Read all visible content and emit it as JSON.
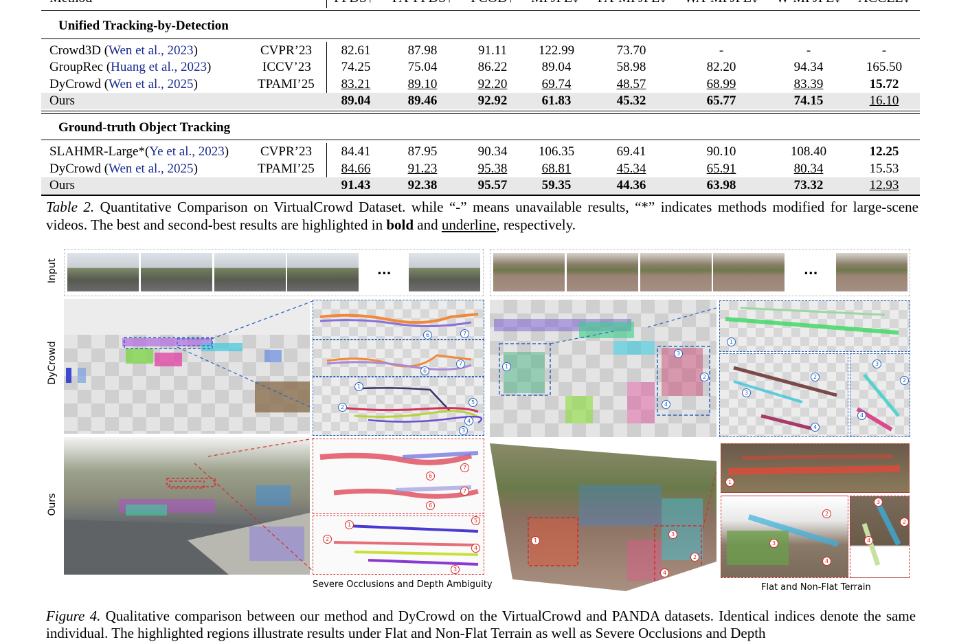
{
  "table": {
    "header": {
      "method": "Method",
      "cols": [
        "PFDS↑",
        "PA-PFDS↑",
        "PCOD↑",
        "MPJPE↓",
        "PA-MPJPE↓",
        "WA-MPJPE↓",
        "W-MPJPE↓",
        "ACCEL↓"
      ]
    },
    "sections": [
      {
        "title": "Unified Tracking-by-Detection",
        "rows": [
          {
            "name": "Crowd3D (",
            "cite": "Wen et al., 2023",
            "close": ")",
            "venue": "CVPR’23",
            "vals": [
              "82.61",
              "87.98",
              "91.11",
              "122.99",
              "73.70",
              "-",
              "-",
              "-"
            ]
          },
          {
            "name": "GroupRec (",
            "cite": "Huang et al., 2023",
            "close": ")",
            "venue": "ICCV’23",
            "vals": [
              "74.25",
              "75.04",
              "86.22",
              "89.04",
              "58.98",
              "82.20",
              "94.34",
              "165.50"
            ]
          },
          {
            "name": "DyCrowd (",
            "cite": "Wen et al., 2025",
            "close": ")",
            "venue": "TPAMI’25",
            "vals": [
              "83.21",
              "89.10",
              "92.20",
              "69.74",
              "48.57",
              "68.99",
              "83.39",
              "15.72"
            ]
          },
          {
            "name": "Ours",
            "cite": "",
            "close": "",
            "venue": "",
            "vals": [
              "89.04",
              "89.46",
              "92.92",
              "61.83",
              "45.32",
              "65.77",
              "74.15",
              "16.10"
            ]
          }
        ]
      },
      {
        "title": "Ground-truth Object Tracking",
        "rows": [
          {
            "name": "SLAHMR-Large*(",
            "cite": "Ye et al., 2023",
            "close": ")",
            "venue": "CVPR’23",
            "vals": [
              "84.41",
              "87.95",
              "90.34",
              "106.35",
              "69.41",
              "90.10",
              "108.40",
              "12.25"
            ]
          },
          {
            "name": "DyCrowd (",
            "cite": "Wen et al., 2025",
            "close": ")",
            "venue": "TPAMI’25",
            "vals": [
              "84.66",
              "91.23",
              "95.38",
              "68.81",
              "45.34",
              "65.91",
              "80.34",
              "15.53"
            ]
          },
          {
            "name": "Ours",
            "cite": "",
            "close": "",
            "venue": "",
            "vals": [
              "91.43",
              "92.38",
              "95.57",
              "59.35",
              "44.36",
              "63.98",
              "73.32",
              "12.93"
            ]
          }
        ]
      }
    ],
    "caption": {
      "label": "Table 2.",
      "text1": "Quantitative Comparison on VirtualCrowd Dataset. while “-” means unavailable results, “*” indicates methods modified for large-scene videos. The best and second-best results are highlighted in",
      "bold": "bold",
      "and": "and",
      "underline": "underline",
      "end": ", respectively."
    }
  },
  "figure": {
    "row_labels": {
      "input": "Input",
      "dycrowd": "DyCrowd",
      "ours": "Ours"
    },
    "ellipsis": "...",
    "sublabel_left": "Severe Occlusions and Depth Ambiguity",
    "sublabel_right": "Flat and Non-Flat Terrain",
    "caption": {
      "label": "Figure 4.",
      "text": "Qualitative comparison between our method and DyCrowd on the VirtualCrowd and PANDA datasets. Identical indices denote the same individual. The highlighted regions illustrate results under Flat and Non-Flat Terrain as well as Severe Occlusions and Depth"
    }
  },
  "colors": {
    "citation": "#1a2a8f",
    "highlight_row": "#e8e8e8",
    "inset_blue": "#2a64c0",
    "inset_red": "#d62a2a"
  }
}
